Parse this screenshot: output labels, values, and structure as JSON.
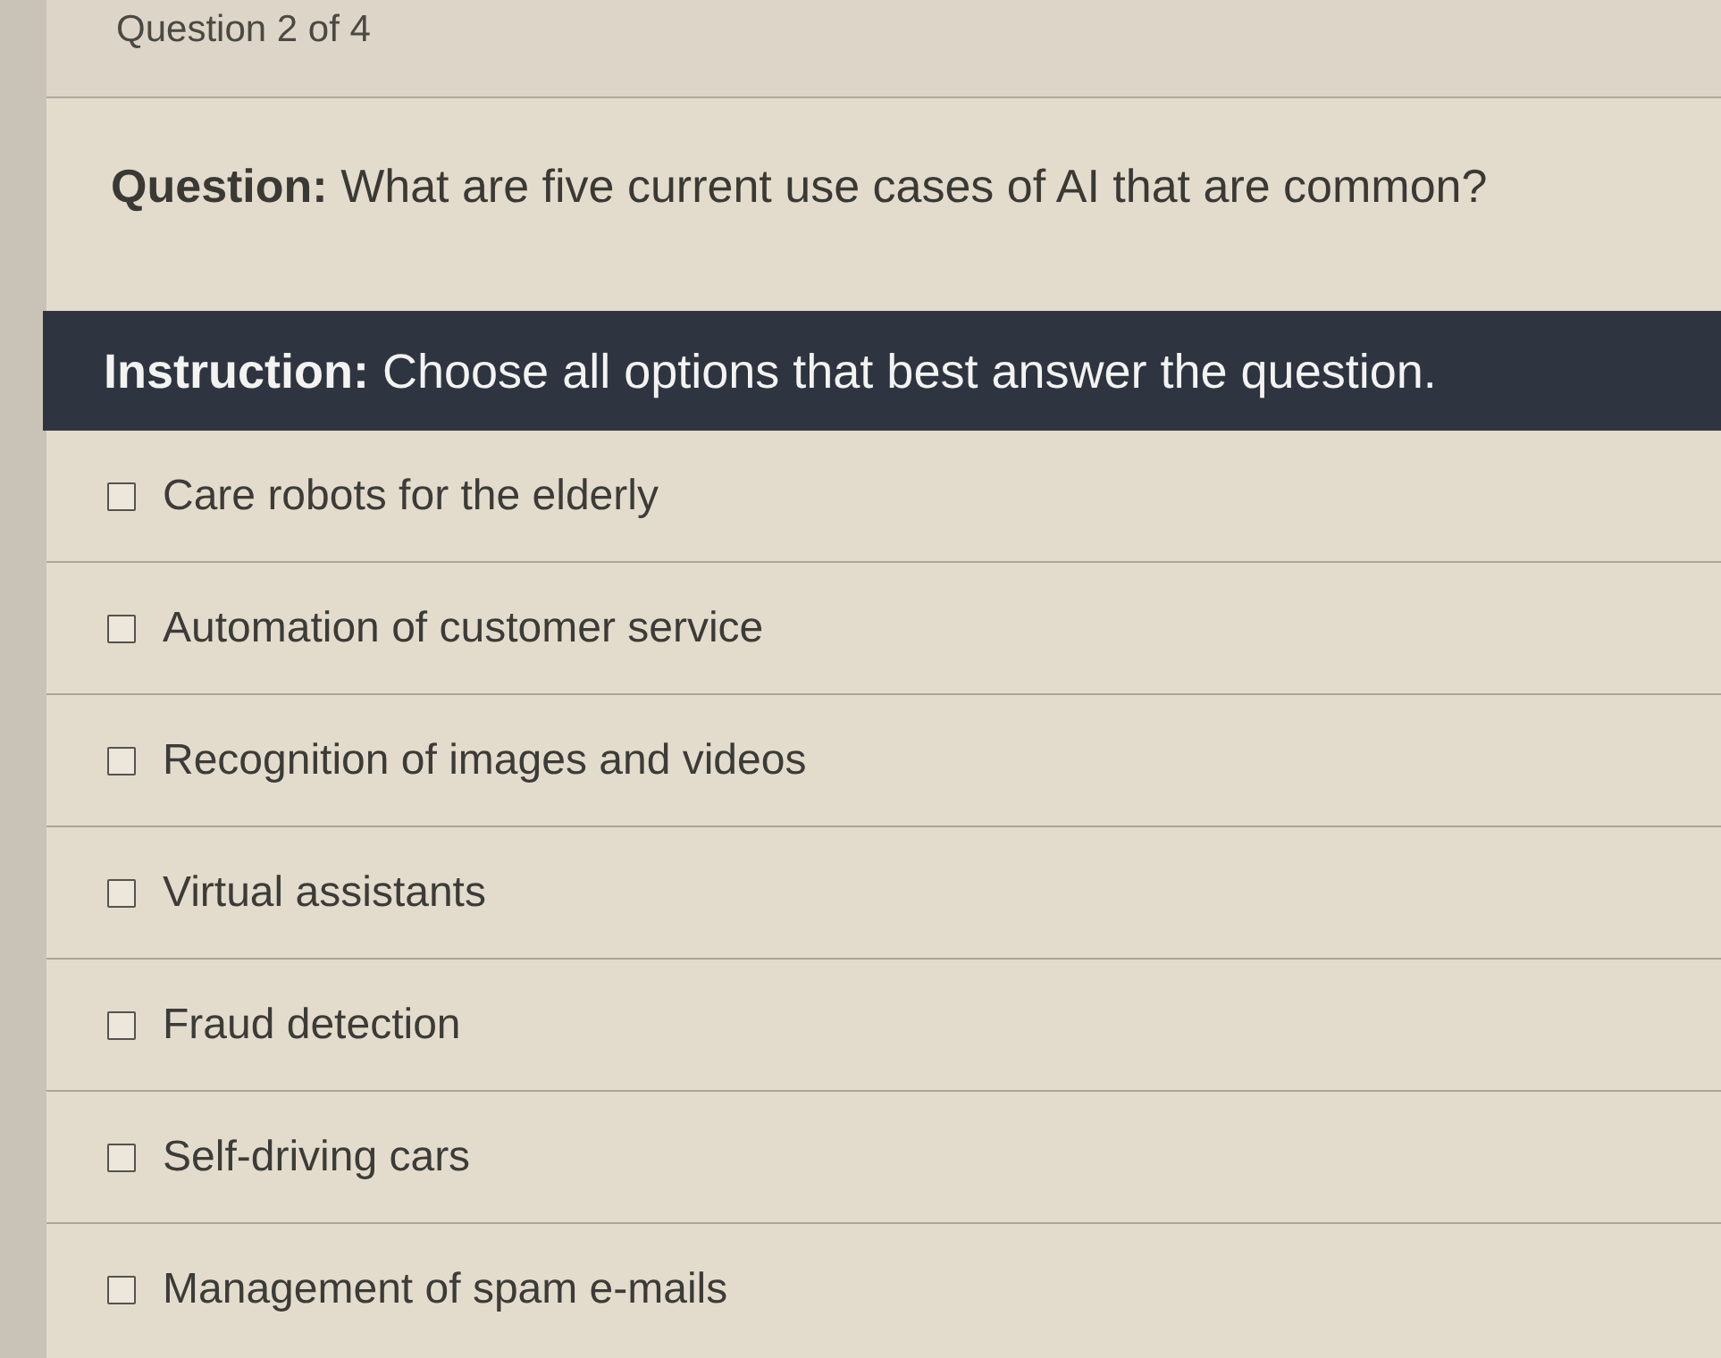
{
  "header": {
    "title": "Question 2 of 4"
  },
  "question": {
    "text": "**Question:** What are five current use cases of AI that are common?"
  },
  "instruction": {
    "text": "**Instruction:** Choose all options that best answer the question."
  },
  "options": [
    {
      "label": "Care robots for the elderly",
      "checked": false
    },
    {
      "label": "Automation of customer service",
      "checked": false
    },
    {
      "label": "Recognition of images and videos",
      "checked": false
    },
    {
      "label": "Virtual assistants",
      "checked": false
    },
    {
      "label": "Fraud detection",
      "checked": false
    },
    {
      "label": "Self-driving cars",
      "checked": false
    },
    {
      "label": "Management of spam e-mails",
      "checked": false
    }
  ]
}
